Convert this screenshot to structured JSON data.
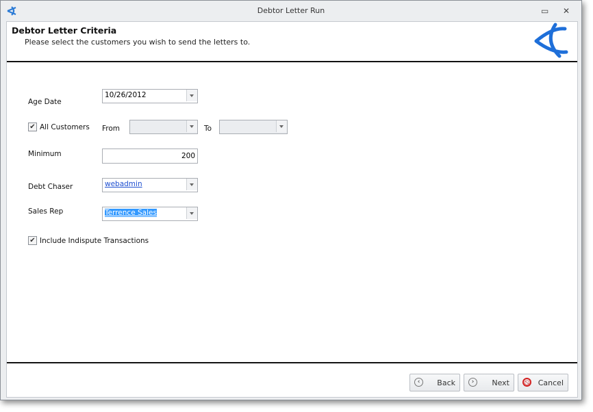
{
  "window": {
    "title": "Debtor Letter Run"
  },
  "header": {
    "title": "Debtor Letter Criteria",
    "subtitle": "Please select the customers you wish to send the letters to."
  },
  "form": {
    "age_date": {
      "label": "Age Date",
      "value": "10/26/2012"
    },
    "all_customers": {
      "label": "All Customers",
      "checked": true
    },
    "from": {
      "label": "From",
      "value": ""
    },
    "to": {
      "label": "To",
      "value": ""
    },
    "minimum": {
      "label": "Minimum",
      "value": "200"
    },
    "debt_chaser": {
      "label": "Debt Chaser",
      "value": "webadmin"
    },
    "sales_rep": {
      "label": "Sales Rep",
      "value": "Terrence Sales"
    },
    "include_indispute": {
      "label": "Include Indispute Transactions",
      "checked": true
    }
  },
  "footer": {
    "back": "Back",
    "next": "Next",
    "cancel": "Cancel"
  },
  "colors": {
    "accent": "#1e6fd9",
    "selection": "#3399ff"
  }
}
